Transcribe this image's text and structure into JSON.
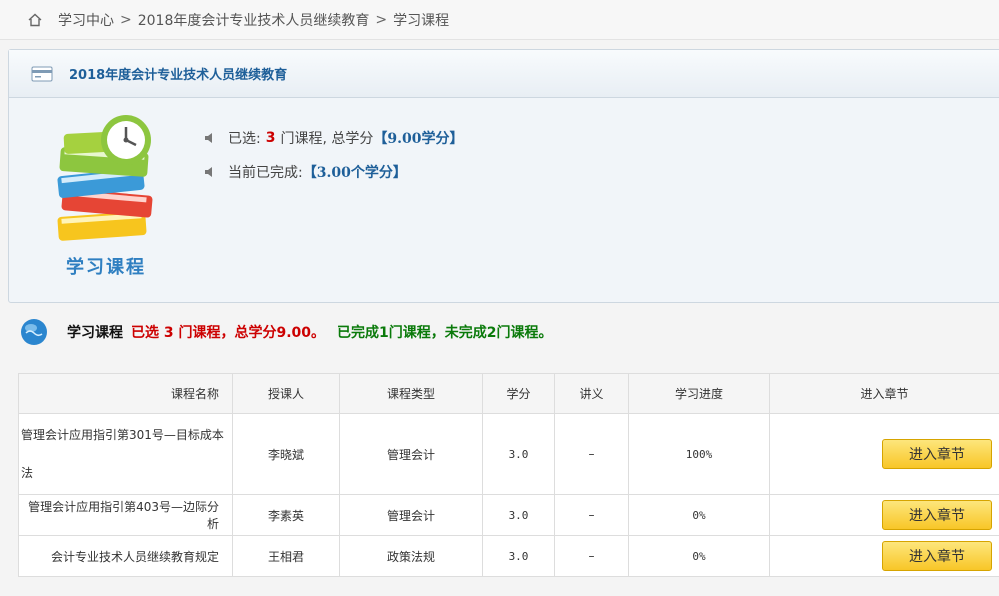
{
  "breadcrumb": {
    "items": [
      "学习中心",
      "2018年度会计专业技术人员继续教育",
      "学习课程"
    ],
    "separator": ">"
  },
  "panel": {
    "title": "2018年度会计专业技术人员继续教育",
    "image_label": "学习课程",
    "selected_prefix": "已选:",
    "selected_count": "3",
    "selected_suffix": "门课程, 总学分",
    "total_credits": "【9.00学分】",
    "completed_prefix": "当前已完成:",
    "completed_credits": "【3.00个学分】"
  },
  "summary": {
    "label": "学习课程",
    "selected_text": "已选 3 门课程，总学分9.00。",
    "completed_text": "已完成1门课程，未完成2门课程。"
  },
  "table": {
    "headers": [
      "课程名称",
      "授课人",
      "课程类型",
      "学分",
      "讲义",
      "学习进度",
      "进入章节"
    ],
    "rows": [
      {
        "name": "管理会计应用指引第301号—目标成本法",
        "teacher": "李晓斌",
        "type": "管理会计",
        "credit": "3.0",
        "notes": "–",
        "progress": "100%",
        "action": "进入章节"
      },
      {
        "name": "管理会计应用指引第403号—边际分析",
        "teacher": "李素英",
        "type": "管理会计",
        "credit": "3.0",
        "notes": "–",
        "progress": "0%",
        "action": "进入章节"
      },
      {
        "name": "会计专业技术人员继续教育规定",
        "teacher": "王相君",
        "type": "政策法规",
        "credit": "3.0",
        "notes": "–",
        "progress": "0%",
        "action": "进入章节"
      }
    ]
  },
  "colors": {
    "accent_blue": "#1e5f99",
    "red": "#cc0000",
    "green": "#0a7a0a",
    "button": "#f8c627"
  },
  "icons": [
    "home-icon",
    "card-icon",
    "speaker-icon",
    "globe-icon",
    "books-clock-illustration"
  ]
}
